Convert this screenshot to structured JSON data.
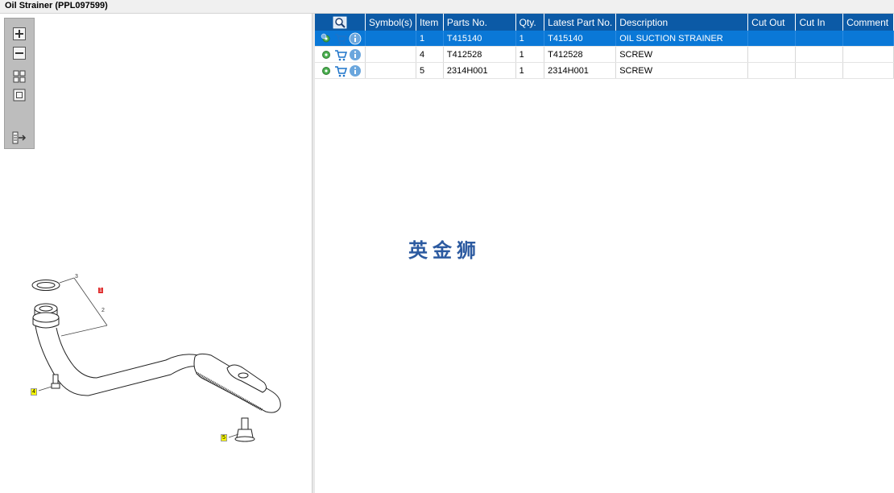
{
  "window": {
    "title": "Oil Strainer (PPL097599)"
  },
  "toolbar": {
    "buttons": [
      {
        "name": "zoom-in-button",
        "icon": "plus-icon"
      },
      {
        "name": "zoom-out-button",
        "icon": "minus-icon"
      },
      {
        "name": "fit-all-button",
        "icon": "grid-icon"
      },
      {
        "name": "fit-window-button",
        "icon": "square-icon"
      },
      {
        "name": "export-button",
        "icon": "list-arrow-icon"
      }
    ]
  },
  "diagram": {
    "callouts": [
      "1",
      "2",
      "3",
      "4",
      "5"
    ]
  },
  "table": {
    "headers": [
      "",
      "Symbol(s)",
      "Item",
      "Parts No.",
      "Qty.",
      "Latest Part No.",
      "Description",
      "Cut Out",
      "Cut In",
      "Comment"
    ],
    "rows": [
      {
        "item": "1",
        "part_no": "T415140",
        "qty": "1",
        "latest": "T415140",
        "description": "OIL SUCTION STRAINER",
        "cut_out": "",
        "cut_in": "",
        "comment": "",
        "selected": true
      },
      {
        "item": "4",
        "part_no": "T412528",
        "qty": "1",
        "latest": "T412528",
        "description": "SCREW",
        "cut_out": "",
        "cut_in": "",
        "comment": "",
        "selected": false
      },
      {
        "item": "5",
        "part_no": "2314H001",
        "qty": "1",
        "latest": "2314H001",
        "description": "SCREW",
        "cut_out": "",
        "cut_in": "",
        "comment": "",
        "selected": false
      }
    ]
  },
  "watermark": "英金狮",
  "colors": {
    "header_blue": "#0c5aa6",
    "selected_row": "#0a78d7",
    "callout_red": "#e03030",
    "callout_yellow": "#ffff00"
  }
}
